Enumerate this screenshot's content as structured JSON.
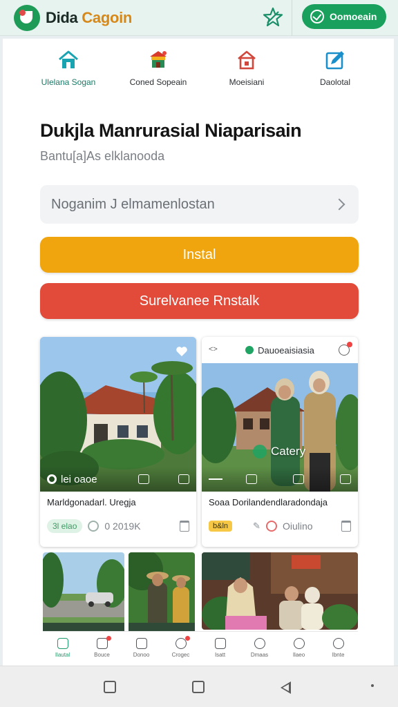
{
  "header": {
    "brand_part1": "Dida",
    "brand_part2": "Cagoin",
    "action_label": "Oomoeain"
  },
  "categories": [
    {
      "label": "Ulelana Sogan",
      "icon": "home-icon",
      "active": true
    },
    {
      "label": "Coned Sopeain",
      "icon": "temple-icon"
    },
    {
      "label": "Moeisiani",
      "icon": "house-icon"
    },
    {
      "label": "Daolotal",
      "icon": "edit-icon"
    }
  ],
  "hero": {
    "title": "Dukjla Manrurasial Niaparisain",
    "subtitle": "Bantu[a]As elklanooda"
  },
  "search": {
    "placeholder": "Noganim J elmamenlostan"
  },
  "buttons": {
    "install": "Instal",
    "alert": "Surelvanee Rnstalk"
  },
  "cards": [
    {
      "overlay": "lei oaoe",
      "title": "Marldgonadarl. Uregja",
      "meta_pill": "3l elao",
      "meta_value": "0 2019K"
    },
    {
      "header_left": "<>",
      "header_title": "Dauoeaisiasia",
      "overlay": "Catery",
      "title": "Soaa Dorilandendlaradondaja",
      "meta_pill": "b&ln",
      "meta_value": "Oiulino"
    }
  ],
  "bottom_nav": [
    {
      "label": "Ilautal",
      "icon": "home-icon",
      "active": true
    },
    {
      "label": "Bouce",
      "icon": "tag-icon",
      "badge": true
    },
    {
      "label": "Donoo",
      "icon": "calendar-icon"
    },
    {
      "label": "Crogec",
      "icon": "heart-icon",
      "badge": true
    },
    {
      "label": "Isatt",
      "icon": "bag-icon"
    },
    {
      "label": "Dmaas",
      "icon": "chat-icon"
    },
    {
      "label": "Ilaeo",
      "icon": "search-icon"
    },
    {
      "label": "Ibnte",
      "icon": "user-icon"
    }
  ],
  "colors": {
    "brand_green": "#18a05c",
    "install_yellow": "#f0a40e",
    "alert_red": "#e24a3a",
    "active_teal": "#1b7a68"
  }
}
